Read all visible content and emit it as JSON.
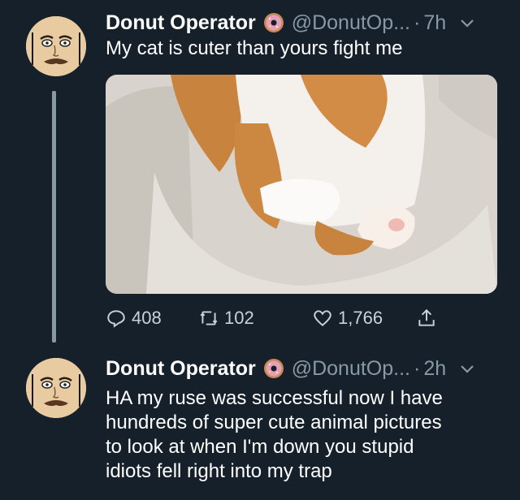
{
  "tweets": [
    {
      "author": "Donut Operator",
      "handle": "@DonutOp...",
      "separator": "·",
      "time": "7h",
      "text": "My cat is cuter than yours fight me",
      "media": "orange-and-white cat sleeping belly-up in a pet bed",
      "replies": "408",
      "retweets": "102",
      "likes": "1,766"
    },
    {
      "author": "Donut Operator",
      "handle": "@DonutOp...",
      "separator": "·",
      "time": "2h",
      "lines": [
        "HA my ruse was successful now I have",
        "hundreds of super cute animal pictures",
        "to look at when I'm down you stupid",
        "idiots fell right into my trap"
      ]
    }
  ],
  "icons": {
    "author_badge": "donut-icon",
    "menu": "chevron-down-icon",
    "reply": "reply-icon",
    "retweet": "retweet-icon",
    "like": "heart-icon",
    "share": "share-icon"
  },
  "colors": {
    "background": "#15202b",
    "text": "#ffffff",
    "secondary": "#8899a6"
  }
}
